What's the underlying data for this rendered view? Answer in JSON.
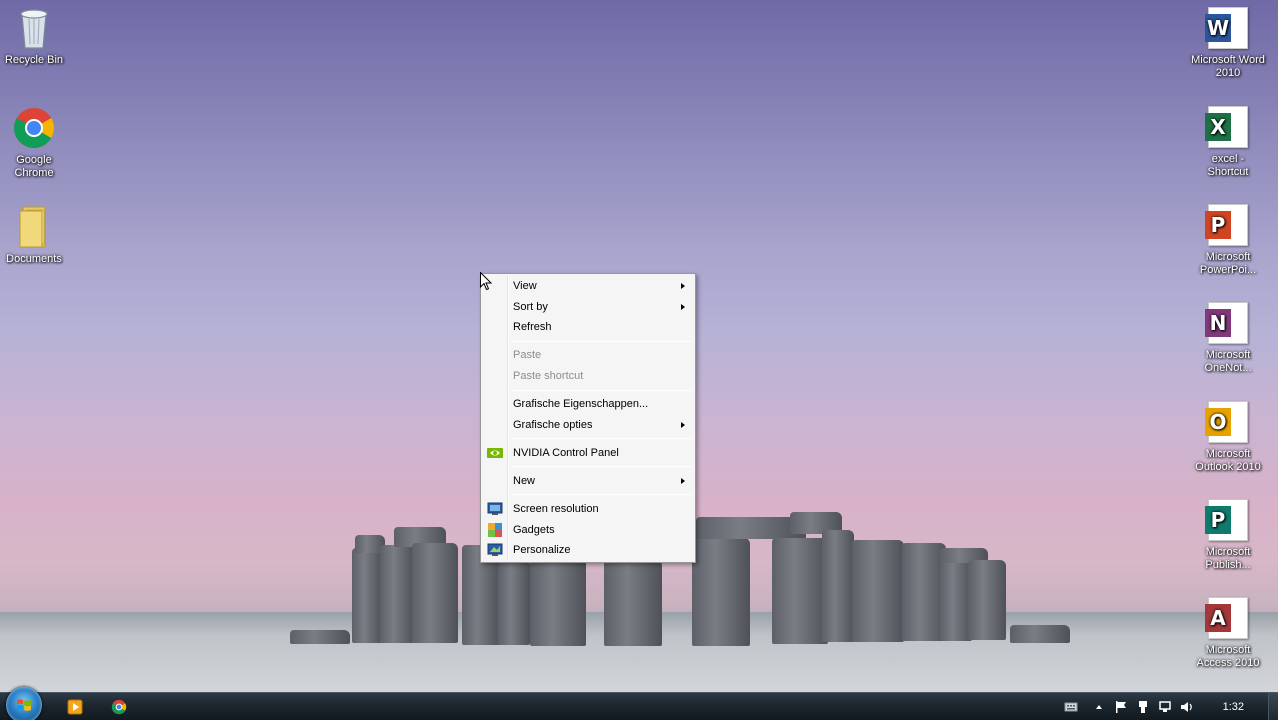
{
  "desktop": {
    "left_icons": [
      {
        "name": "recycle-bin",
        "label": "Recycle Bin",
        "icon": "recycle-bin-icon"
      },
      {
        "name": "google-chrome",
        "label": "Google Chrome",
        "icon": "chrome-icon"
      },
      {
        "name": "documents",
        "label": "Documents",
        "icon": "folder-icon"
      }
    ],
    "right_icons": [
      {
        "name": "word",
        "label": "Microsoft Word 2010",
        "letter": "W",
        "color": "#2b579a",
        "icon": "word-icon"
      },
      {
        "name": "excel",
        "label": "excel - Shortcut",
        "letter": "X",
        "color": "#1e7145",
        "icon": "excel-icon"
      },
      {
        "name": "powerpoint",
        "label": "Microsoft PowerPoi...",
        "letter": "P",
        "color": "#d04423",
        "icon": "powerpoint-icon"
      },
      {
        "name": "onenote",
        "label": "Microsoft OneNot...",
        "letter": "N",
        "color": "#80397b",
        "icon": "onenote-icon"
      },
      {
        "name": "outlook",
        "label": "Microsoft Outlook 2010",
        "letter": "O",
        "color": "#e8a200",
        "icon": "outlook-icon"
      },
      {
        "name": "publisher",
        "label": "Microsoft Publish...",
        "letter": "P",
        "color": "#0f7b6c",
        "icon": "publisher-icon"
      },
      {
        "name": "access",
        "label": "Microsoft Access 2010",
        "letter": "A",
        "color": "#a4373a",
        "icon": "access-icon"
      }
    ]
  },
  "context_menu": {
    "items": [
      {
        "label": "View",
        "submenu": true,
        "disabled": false
      },
      {
        "label": "Sort by",
        "submenu": true,
        "disabled": false
      },
      {
        "label": "Refresh",
        "submenu": false,
        "disabled": false
      },
      {
        "label": "Paste",
        "submenu": false,
        "disabled": true
      },
      {
        "label": "Paste shortcut",
        "submenu": false,
        "disabled": true
      },
      {
        "label": "Grafische Eigenschappen...",
        "submenu": false,
        "disabled": false
      },
      {
        "label": "Grafische opties",
        "submenu": true,
        "disabled": false
      },
      {
        "label": "NVIDIA Control Panel",
        "submenu": false,
        "disabled": false,
        "icon": "nvidia-icon"
      },
      {
        "label": "New",
        "submenu": true,
        "disabled": false
      },
      {
        "label": "Screen resolution",
        "submenu": false,
        "disabled": false,
        "icon": "monitor-icon"
      },
      {
        "label": "Gadgets",
        "submenu": false,
        "disabled": false,
        "icon": "gadgets-icon"
      },
      {
        "label": "Personalize",
        "submenu": false,
        "disabled": false,
        "icon": "personalize-icon"
      }
    ]
  },
  "taskbar": {
    "pinned": [
      {
        "name": "media-player",
        "icon": "media-player-icon"
      },
      {
        "name": "chrome",
        "icon": "chrome-icon"
      }
    ],
    "tray_icons": [
      "keyboard-icon",
      "show-hidden-icon",
      "action-center-flag-icon",
      "usb-device-icon",
      "network-icon",
      "volume-icon"
    ],
    "clock": "1:32"
  }
}
